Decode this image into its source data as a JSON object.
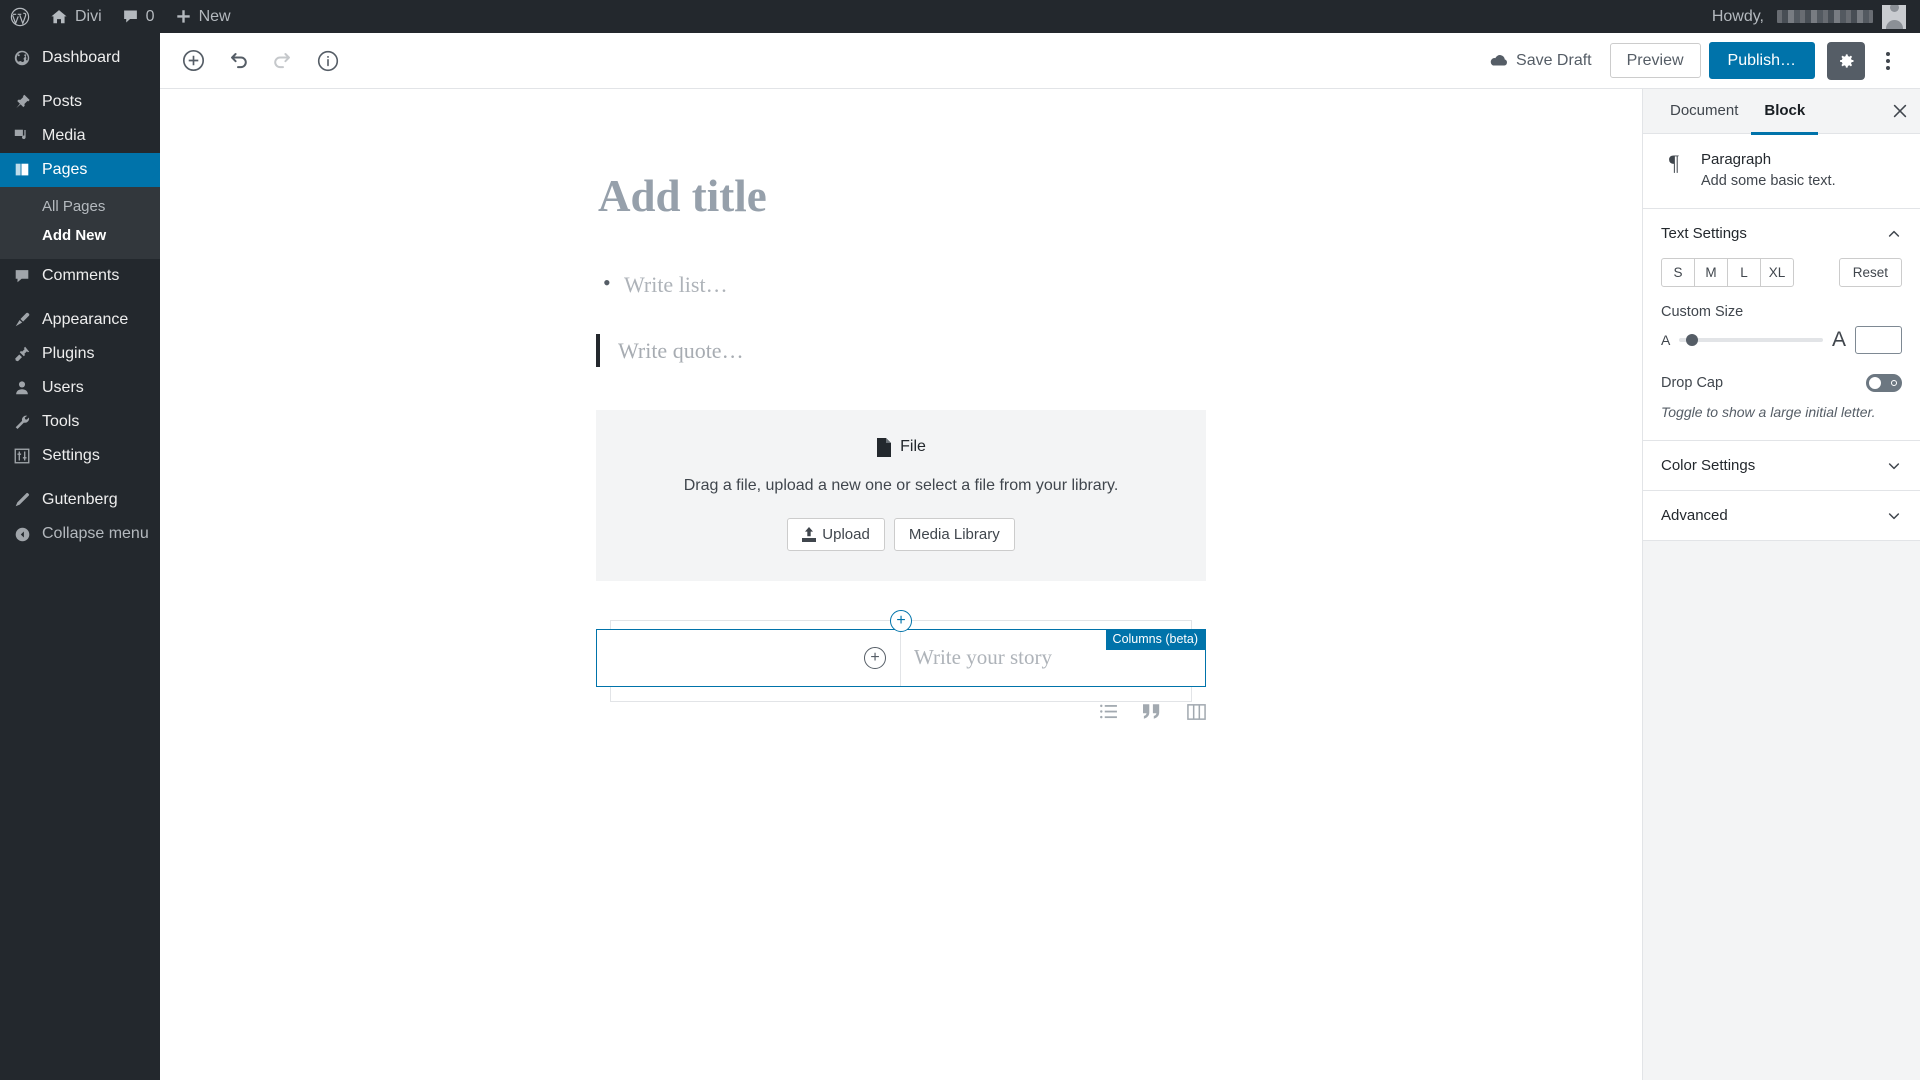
{
  "adminbar": {
    "wp_logo": "wordpress-logo-icon",
    "site_name": "Divi",
    "comments_count": "0",
    "new_label": "New",
    "howdy_label": "Howdy,",
    "username_redacted": true
  },
  "adminmenu": {
    "items": [
      {
        "label": "Dashboard",
        "icon": "dashboard-icon",
        "current": false
      },
      {
        "label": "Posts",
        "icon": "pin-icon",
        "current": false
      },
      {
        "label": "Media",
        "icon": "media-icon",
        "current": false
      },
      {
        "label": "Pages",
        "icon": "pages-icon",
        "current": true
      },
      {
        "label": "Comments",
        "icon": "comment-icon",
        "current": false
      },
      {
        "label": "Appearance",
        "icon": "brush-icon",
        "current": false
      },
      {
        "label": "Plugins",
        "icon": "plugin-icon",
        "current": false
      },
      {
        "label": "Users",
        "icon": "user-icon",
        "current": false
      },
      {
        "label": "Tools",
        "icon": "wrench-icon",
        "current": false
      },
      {
        "label": "Settings",
        "icon": "settings-icon",
        "current": false
      },
      {
        "label": "Gutenberg",
        "icon": "pencil-icon",
        "current": false
      }
    ],
    "submenu": [
      {
        "label": "All Pages",
        "current": false
      },
      {
        "label": "Add New",
        "current": true
      }
    ],
    "collapse_label": "Collapse menu",
    "highlight_color": "#0073aa"
  },
  "header": {
    "add_block_icon": "circle-plus-icon",
    "undo_icon": "undo-icon",
    "redo_icon": "redo-icon",
    "info_icon": "info-icon",
    "save_draft_label": "Save Draft",
    "save_draft_icon": "cloud-icon",
    "preview_label": "Preview",
    "publish_label": "Publish…",
    "settings_icon": "gear-icon",
    "more_icon": "kebab-menu-icon",
    "publish_color": "#0073aa"
  },
  "canvas": {
    "title_placeholder": "Add title",
    "list_placeholder": "Write list…",
    "quote_placeholder": "Write quote…",
    "file_block": {
      "icon": "file-icon",
      "label": "File",
      "description": "Drag a file, upload a new one or select a file from your library.",
      "upload_label": "Upload",
      "upload_icon": "upload-icon",
      "media_library_label": "Media Library"
    },
    "columns_block": {
      "badge": "Columns (beta)",
      "badge_color": "#0073aa",
      "selection_color": "#0073aa",
      "column_inserter_icon": "circle-plus-icon",
      "top_inserter_icon": "circle-plus-icon",
      "paragraph_placeholder": "Write your story"
    },
    "block_hints": [
      {
        "icon": "list-icon"
      },
      {
        "icon": "quote-icon"
      },
      {
        "icon": "columns-icon"
      }
    ]
  },
  "sidebar": {
    "tabs": [
      {
        "label": "Document",
        "active": false
      },
      {
        "label": "Block",
        "active": true
      }
    ],
    "close_icon": "close-icon",
    "block": {
      "icon": "paragraph-icon",
      "icon_glyph": "¶",
      "title": "Paragraph",
      "description": "Add some basic text."
    },
    "panels": [
      {
        "title": "Text Settings",
        "expanded": true
      },
      {
        "title": "Color Settings",
        "expanded": false
      },
      {
        "title": "Advanced",
        "expanded": false
      }
    ],
    "text_settings": {
      "sizes": [
        "S",
        "M",
        "L",
        "XL"
      ],
      "reset_label": "Reset",
      "custom_size_label": "Custom Size",
      "slider_min_glyph": "A",
      "slider_max_glyph": "A",
      "slider_value_percent": 9,
      "custom_size_value": "",
      "drop_cap_label": "Drop Cap",
      "drop_cap_on": false,
      "drop_cap_help": "Toggle to show a large initial letter."
    }
  }
}
